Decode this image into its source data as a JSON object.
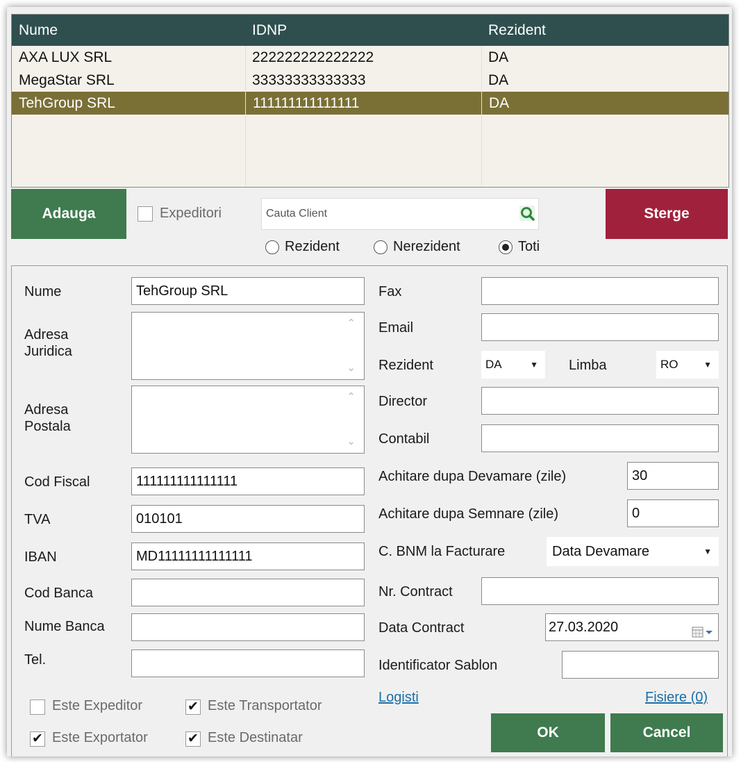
{
  "grid": {
    "columns": [
      "Nume",
      "IDNP",
      "Rezident"
    ],
    "rows": [
      {
        "nume": "AXA LUX SRL",
        "idnp": "222222222222222",
        "rezident": "DA"
      },
      {
        "nume": "MegaStar SRL",
        "idnp": "33333333333333",
        "rezident": "DA"
      },
      {
        "nume": "TehGroup SRL",
        "idnp": "111111111111111",
        "rezident": "DA"
      }
    ]
  },
  "toolbar": {
    "add_label": "Adauga",
    "expeditori_label": "Expeditori",
    "search_placeholder": "Cauta Client",
    "delete_label": "Sterge",
    "filter_rezident": "Rezident",
    "filter_nerezident": "Nerezident",
    "filter_toti": "Toti",
    "filter_selected": "Toti"
  },
  "form": {
    "labels": {
      "nume": "Nume",
      "adresa_juridica_1": "Adresa",
      "adresa_juridica_2": "Juridica",
      "adresa_postala_1": "Adresa",
      "adresa_postala_2": "Postala",
      "cod_fiscal": "Cod Fiscal",
      "tva": "TVA",
      "iban": "IBAN",
      "cod_banca": "Cod Banca",
      "nume_banca": "Nume Banca",
      "tel": "Tel.",
      "fax": "Fax",
      "email": "Email",
      "rezident": "Rezident",
      "limba": "Limba",
      "director": "Director",
      "contabil": "Contabil",
      "achitare_devamare": "Achitare dupa Devamare (zile)",
      "achitare_semnare": "Achitare dupa Semnare (zile)",
      "bnm_facturare": "C. BNM la Facturare",
      "nr_contract": "Nr. Contract",
      "data_contract": "Data Contract",
      "identificator_sablon": "Identificator Sablon"
    },
    "values": {
      "nume": "TehGroup SRL",
      "adresa_juridica": "",
      "adresa_postala": "",
      "cod_fiscal": "111111111111111",
      "tva": "010101",
      "iban": "MD11111111111111",
      "cod_banca": "",
      "nume_banca": "",
      "tel": "",
      "fax": "",
      "email": "",
      "rezident": "DA",
      "limba": "RO",
      "director": "",
      "contabil": "",
      "achitare_devamare": "30",
      "achitare_semnare": "0",
      "bnm_facturare": "Data Devamare",
      "nr_contract": "",
      "data_contract": "27.03.2020",
      "identificator_sablon": ""
    },
    "checkboxes": {
      "este_expeditor": {
        "label": "Este Expeditor",
        "checked": false
      },
      "este_transportator": {
        "label": "Este Transportator",
        "checked": true
      },
      "este_exportator": {
        "label": "Este Exportator",
        "checked": true
      },
      "este_destinatar": {
        "label": "Este Destinatar",
        "checked": true
      }
    },
    "links": {
      "logisti": "Logisti",
      "fisiere": "Fisiere (0)"
    },
    "buttons": {
      "ok": "OK",
      "cancel": "Cancel"
    }
  },
  "icons": {
    "search": "search-icon",
    "calendar": "calendar-icon",
    "check": "check-icon"
  },
  "colors": {
    "header_bg": "#2f4f4f",
    "selected_row": "#7a7036",
    "green_button": "#3f7b4f",
    "red_button": "#a0213b",
    "link": "#1a6fa8"
  }
}
